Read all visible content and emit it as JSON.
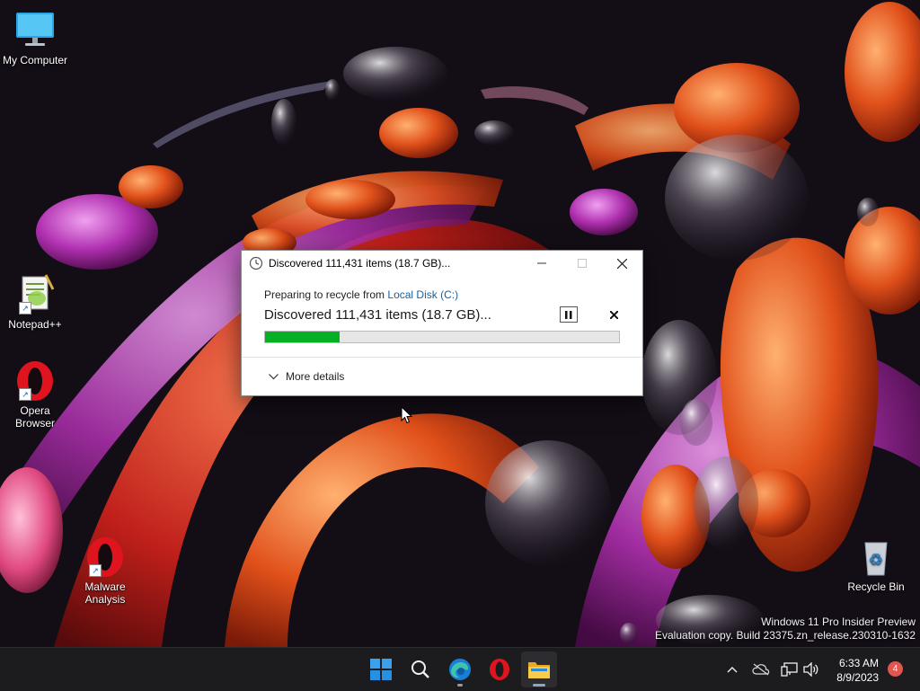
{
  "desktop": {
    "icons": [
      {
        "label": "My Computer"
      },
      {
        "label": "Notepad++"
      },
      {
        "label": "Opera Browser"
      },
      {
        "label": "Malware Analysis"
      },
      {
        "label": "Recycle Bin"
      }
    ]
  },
  "dialog": {
    "title": "Discovered 111,431 items (18.7 GB)...",
    "prep_prefix": "Preparing to recycle from ",
    "prep_source": "Local Disk (C:)",
    "status": "Discovered 111,431 items (18.7 GB)...",
    "progress": 0.21,
    "more_details": "More details"
  },
  "watermark": {
    "line1": "Windows 11 Pro Insider Preview",
    "line2": "Evaluation copy. Build 23375.zn_release.230310-1632"
  },
  "taskbar": {
    "apps": [
      {
        "name": "start",
        "icon": "windows-logo-icon"
      },
      {
        "name": "search",
        "icon": "search-icon"
      },
      {
        "name": "edge",
        "icon": "edge-icon"
      },
      {
        "name": "opera",
        "icon": "opera-icon"
      },
      {
        "name": "file-explorer",
        "icon": "folder-icon",
        "active": true
      }
    ],
    "tray": {
      "time": "6:33 AM",
      "date": "8/9/2023",
      "notifications": "4"
    }
  },
  "colors": {
    "progress_green": "#06b025",
    "link_blue": "#1a5f9e",
    "taskbar_bg": "#1c1c1f",
    "badge_red": "#e0574f"
  }
}
